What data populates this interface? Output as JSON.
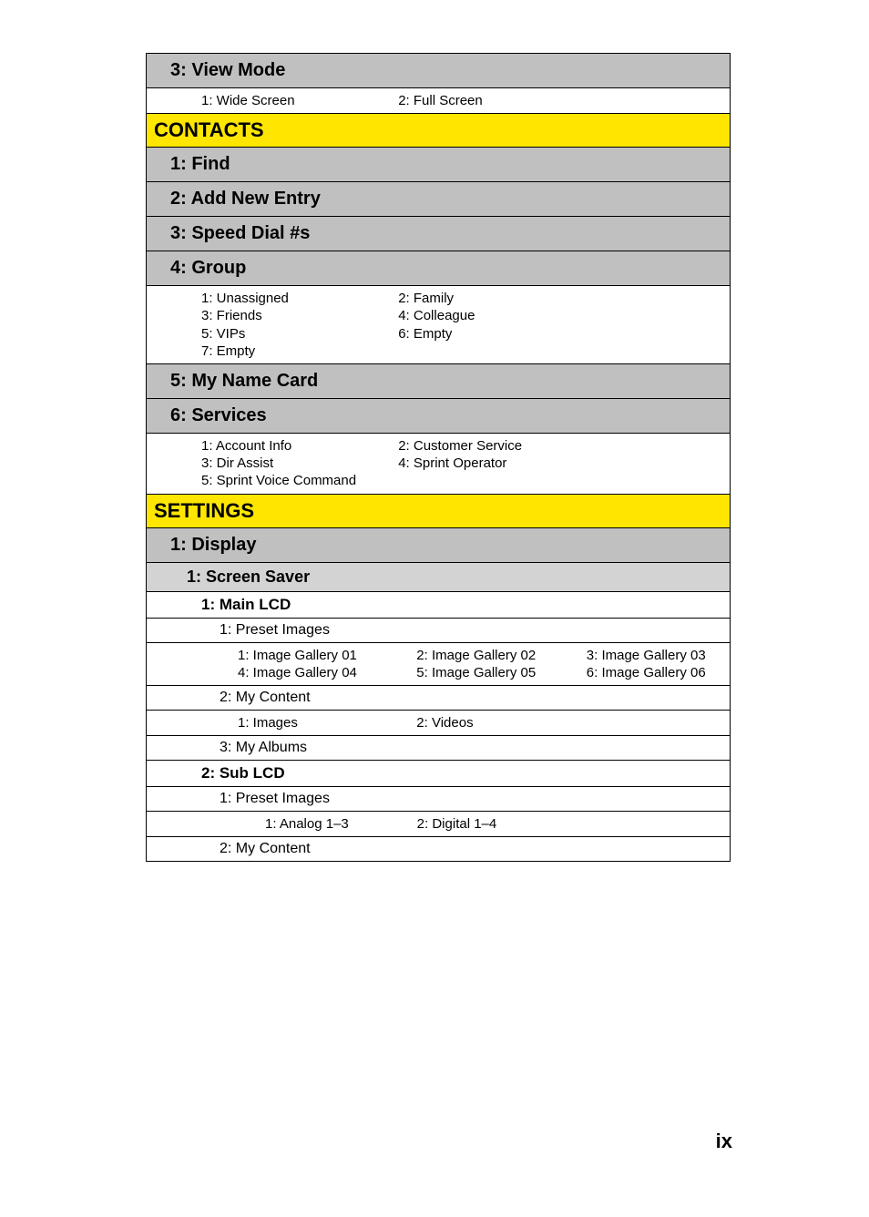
{
  "page_number": "ix",
  "sections": {
    "view_mode": {
      "title": "3: View Mode",
      "items": [
        [
          "1: Wide Screen",
          "2: Full Screen",
          ""
        ]
      ]
    },
    "contacts": {
      "title": "CONTACTS",
      "find": "1: Find",
      "add_new_entry": "2: Add New Entry",
      "speed_dial": "3: Speed Dial #s",
      "group": {
        "title": "4: Group",
        "items": [
          [
            "1: Unassigned",
            "2: Family",
            ""
          ],
          [
            "3: Friends",
            "4: Colleague",
            ""
          ],
          [
            "5: VIPs",
            "6: Empty",
            ""
          ],
          [
            "7: Empty",
            "",
            ""
          ]
        ]
      },
      "my_name_card": "5: My Name Card",
      "services": {
        "title": "6: Services",
        "items": [
          [
            "1: Account Info",
            "2: Customer Service",
            ""
          ],
          [
            "3: Dir Assist",
            "4: Sprint Operator",
            ""
          ],
          [
            "5: Sprint Voice Command",
            "",
            ""
          ]
        ]
      }
    },
    "settings": {
      "title": "SETTINGS",
      "display": {
        "title": "1: Display",
        "screen_saver": {
          "title": "1: Screen Saver",
          "main_lcd": {
            "title": "1: Main LCD",
            "preset_images": {
              "title": "1: Preset Images",
              "items": [
                [
                  "1: Image Gallery 01",
                  "2: Image Gallery 02",
                  "3: Image Gallery 03"
                ],
                [
                  "4: Image Gallery 04",
                  "5: Image Gallery 05",
                  "6: Image Gallery 06"
                ]
              ]
            },
            "my_content": {
              "title": "2: My Content",
              "items": [
                [
                  "1: Images",
                  "2: Videos",
                  ""
                ]
              ]
            },
            "my_albums": {
              "title": "3: My Albums"
            }
          },
          "sub_lcd": {
            "title": "2: Sub LCD",
            "preset_images": {
              "title": "1: Preset Images",
              "items": [
                [
                  "1: Analog 1–3",
                  "2: Digital 1–4",
                  ""
                ]
              ]
            },
            "my_content": {
              "title": "2: My Content"
            }
          }
        }
      }
    }
  }
}
